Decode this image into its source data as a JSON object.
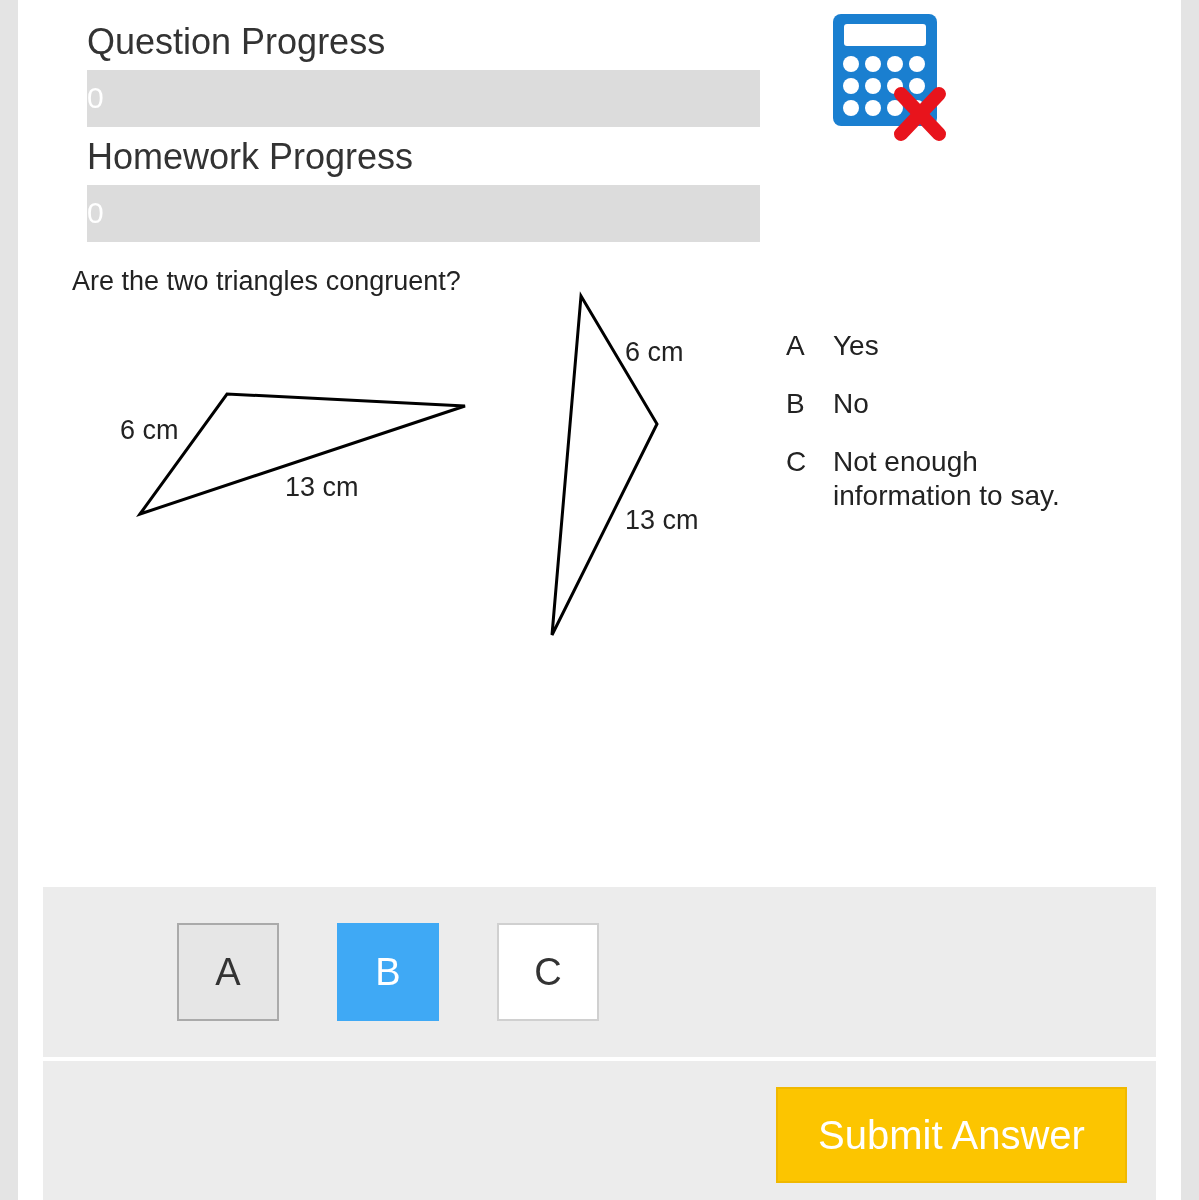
{
  "progress": [
    {
      "label": "Question Progress",
      "reading": "0"
    },
    {
      "label": "Homework Progress",
      "reading": "0"
    }
  ],
  "calculator": {
    "disabled": true
  },
  "question": "Are the two triangles congruent?",
  "figure": {
    "labels": [
      "6 cm",
      "13 cm",
      "6 cm",
      "13 cm"
    ]
  },
  "options": [
    {
      "letter": "A",
      "text": "Yes"
    },
    {
      "letter": "B",
      "text": "No"
    },
    {
      "letter": "C",
      "text": "Not enough information to say."
    }
  ],
  "answers": [
    {
      "label": "A",
      "selected": false,
      "highlighted": true
    },
    {
      "label": "B",
      "selected": true,
      "highlighted": false
    },
    {
      "label": "C",
      "selected": false,
      "highlighted": false
    }
  ],
  "submit": {
    "label": "Submit Answer"
  }
}
